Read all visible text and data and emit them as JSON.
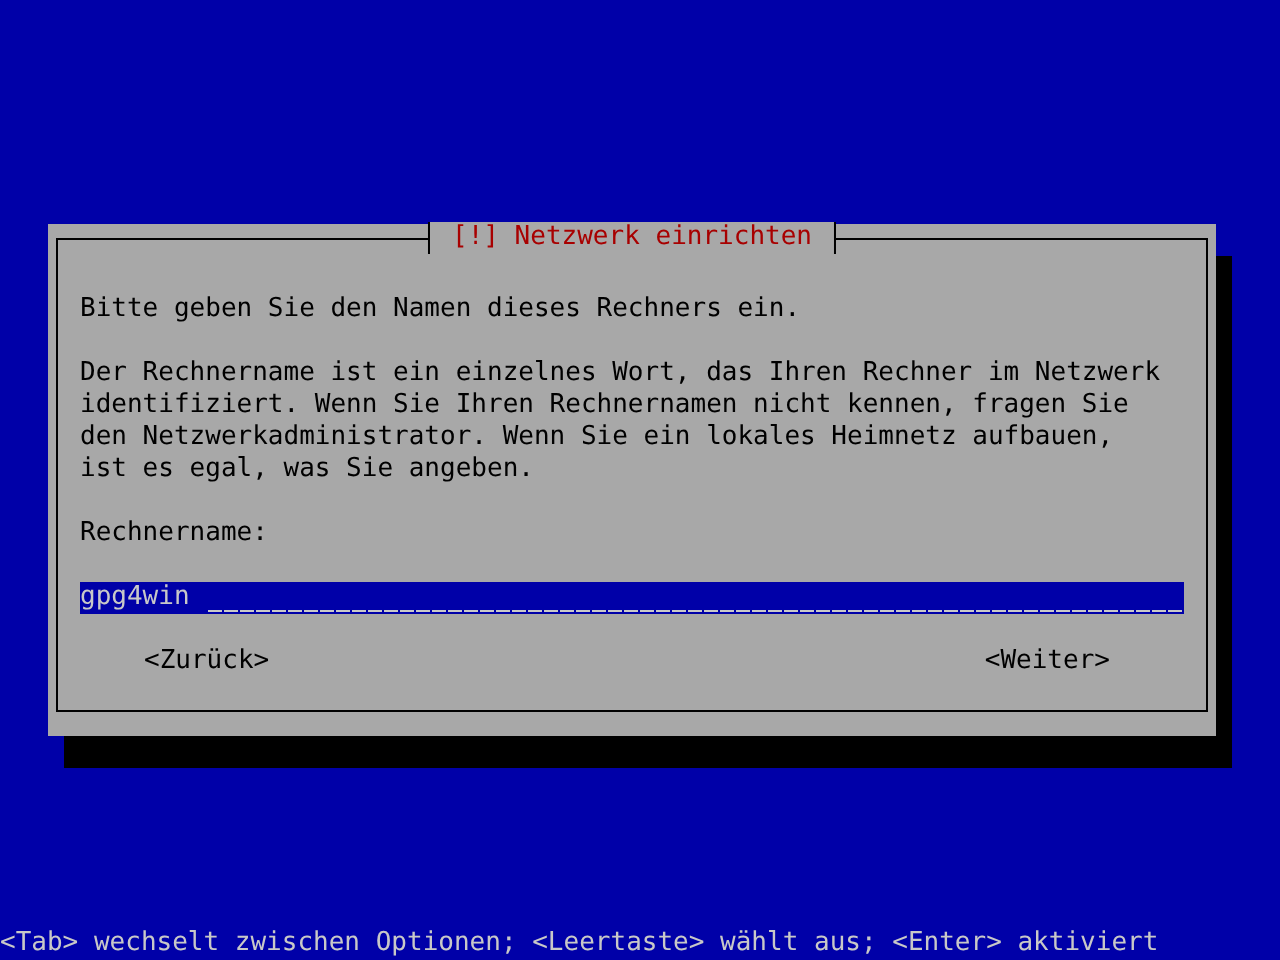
{
  "dialog": {
    "title": "[!] Netzwerk einrichten",
    "paragraphs": [
      "Bitte geben Sie den Namen dieses Rechners ein.",
      "Der Rechnername ist ein einzelnes Wort, das Ihren Rechner im Netzwerk\nidentifiziert. Wenn Sie Ihren Rechnernamen nicht kennen, fragen Sie\nden Netzwerkadministrator. Wenn Sie ein lokales Heimnetz aufbauen,\nist es egal, was Sie angeben."
    ],
    "field": {
      "label": "Rechnername:",
      "value": "gpg4win"
    },
    "buttons": [
      {
        "label": "<Zurück>"
      },
      {
        "label": "<Weiter>"
      }
    ]
  },
  "status_bar": "<Tab> wechselt zwischen Optionen; <Leertaste> wählt aus; <Enter> aktiviert"
}
